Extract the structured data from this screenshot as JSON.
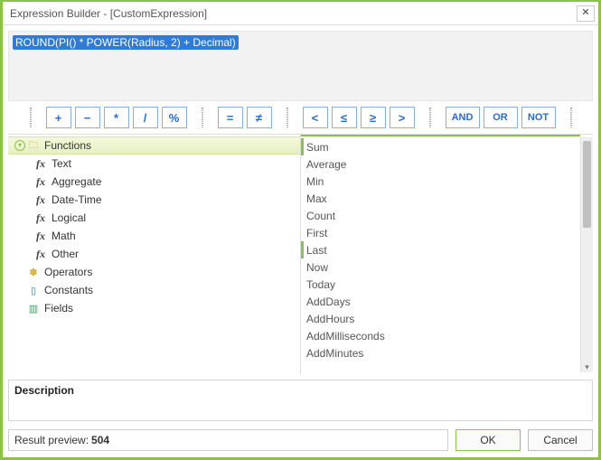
{
  "titlebar": {
    "title": "Expression Builder - [CustomExpression]"
  },
  "expression": "ROUND(PI() * POWER(Radius, 2) + Decimal)",
  "operators": {
    "arith": [
      "+",
      "−",
      "*",
      "/",
      "%"
    ],
    "eq": [
      "=",
      "≠"
    ],
    "cmp": [
      "<",
      "≤",
      "≥",
      ">"
    ],
    "logic": [
      "AND",
      "OR",
      "NOT"
    ]
  },
  "tree": {
    "functions": {
      "label": "Functions",
      "children": [
        "Text",
        "Aggregate",
        "Date-Time",
        "Logical",
        "Math",
        "Other"
      ]
    },
    "operators": "Operators",
    "constants": "Constants",
    "fields": "Fields"
  },
  "function_list": [
    "Sum",
    "Average",
    "Min",
    "Max",
    "Count",
    "First",
    "Last",
    "Now",
    "Today",
    "AddDays",
    "AddHours",
    "AddMilliseconds",
    "AddMinutes"
  ],
  "description": {
    "label": "Description"
  },
  "result": {
    "label": "Result preview:",
    "value": "504"
  },
  "buttons": {
    "ok": "OK",
    "cancel": "Cancel"
  }
}
